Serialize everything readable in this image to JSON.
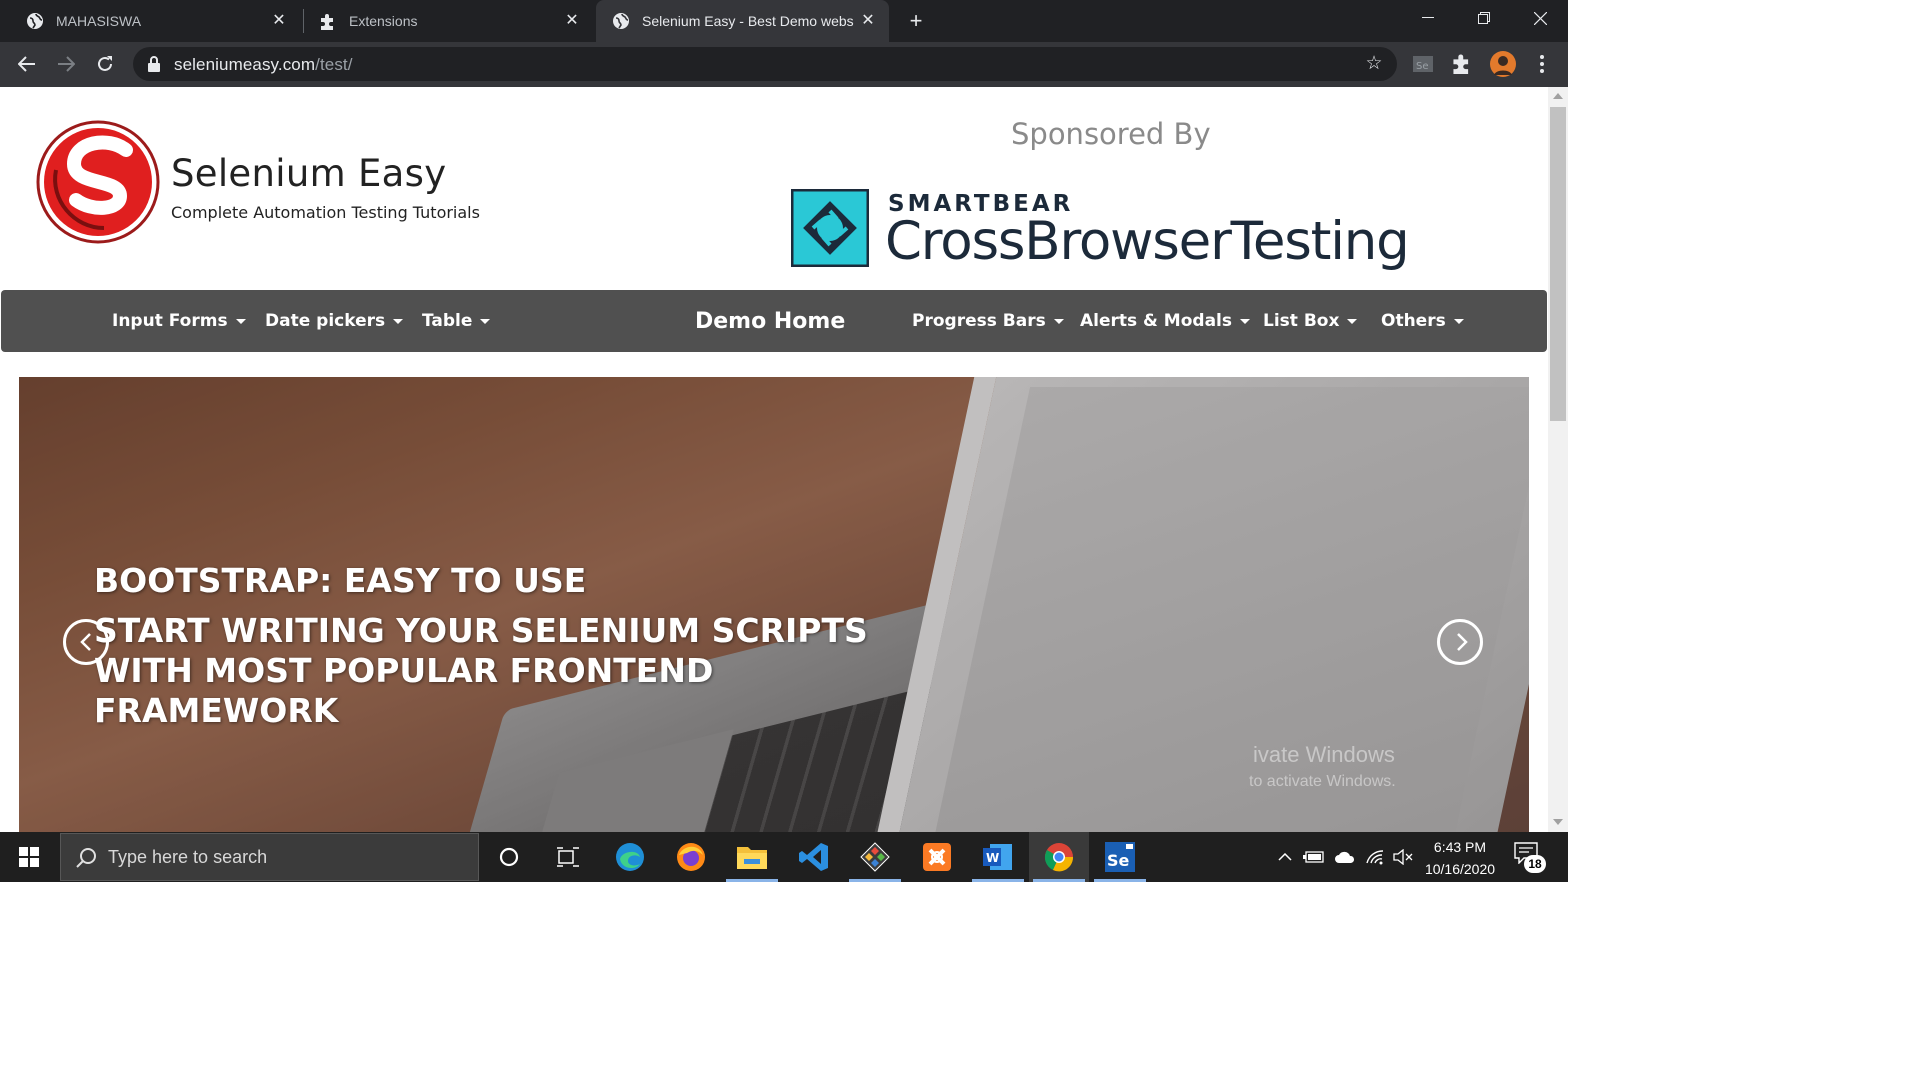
{
  "browser": {
    "tabs": [
      {
        "title": "MAHASISWA",
        "icon": "globe-icon"
      },
      {
        "title": "Extensions",
        "icon": "puzzle-icon"
      },
      {
        "title": "Selenium Easy - Best Demo webs",
        "icon": "globe-icon",
        "active": true
      }
    ],
    "url_host": "seleniumeasy.com",
    "url_path": "/test/"
  },
  "site": {
    "brand_title": "Selenium Easy",
    "brand_subtitle": "Complete Automation Testing Tutorials",
    "sponsored_label": "Sponsored By",
    "sponsor_company": "SMARTBEAR",
    "sponsor_product": "CrossBrowserTesting",
    "menu": [
      {
        "label": "Input Forms",
        "dropdown": true
      },
      {
        "label": "Date pickers",
        "dropdown": true
      },
      {
        "label": "Table",
        "dropdown": true
      },
      {
        "label": "Demo Home",
        "dropdown": false
      },
      {
        "label": "Progress Bars",
        "dropdown": true
      },
      {
        "label": "Alerts & Modals",
        "dropdown": true
      },
      {
        "label": "List Box",
        "dropdown": true
      },
      {
        "label": "Others",
        "dropdown": true
      }
    ],
    "carousel": {
      "heading": "BOOTSTRAP: EASY TO USE",
      "text": "START WRITING YOUR SELENIUM SCRIPTS WITH MOST POPULAR FRONTEND FRAMEWORK"
    },
    "watermark": {
      "line1": "ivate Windows",
      "line2": "to activate Windows."
    }
  },
  "taskbar": {
    "search_placeholder": "Type here to search",
    "time": "6:43 PM",
    "date": "10/16/2020",
    "notification_count": "18"
  }
}
